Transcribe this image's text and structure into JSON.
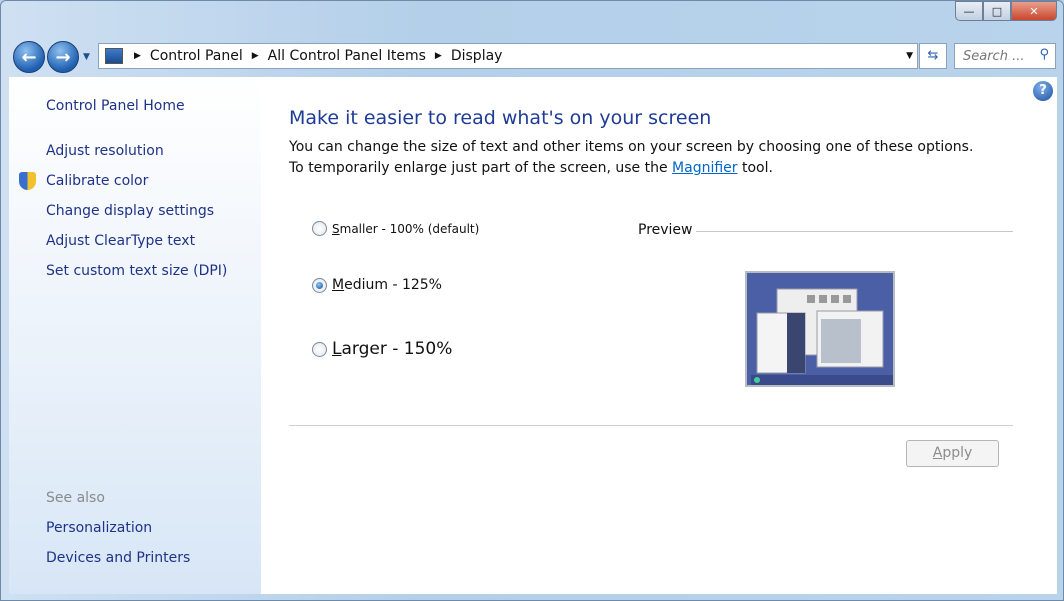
{
  "window": {
    "minimize": "—",
    "maximize": "□",
    "close": "✕"
  },
  "address": {
    "crumbs": [
      "Control Panel",
      "All Control Panel Items",
      "Display"
    ]
  },
  "search": {
    "placeholder": "Search ..."
  },
  "sidebar": {
    "home": "Control Panel Home",
    "items": [
      "Adjust resolution",
      "Calibrate color",
      "Change display settings",
      "Adjust ClearType text",
      "Set custom text size (DPI)"
    ],
    "see_also": "See also",
    "see_also_items": [
      "Personalization",
      "Devices and Printers"
    ]
  },
  "main": {
    "title": "Make it easier to read what's on your screen",
    "desc_1": "You can change the size of text and other items on your screen by choosing one of these options. To temporarily enlarge just part of the screen, use the ",
    "magnifier": "Magnifier",
    "desc_2": " tool.",
    "options": [
      {
        "key": "S",
        "rest": "maller - 100% (default)",
        "selected": false
      },
      {
        "key": "M",
        "rest": "edium - 125%",
        "selected": true
      },
      {
        "key": "L",
        "rest": "arger - 150%",
        "selected": false
      }
    ],
    "preview": "Preview",
    "apply_key": "A",
    "apply_rest": "pply"
  }
}
